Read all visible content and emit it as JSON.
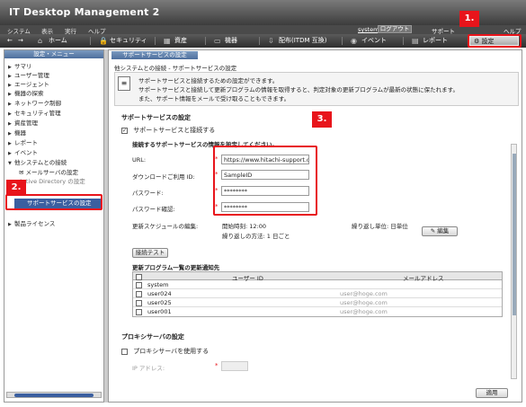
{
  "app_title": "IT Desktop Management 2",
  "menubar": {
    "items": [
      "システム",
      "表示",
      "実行",
      "ヘルプ"
    ],
    "user": "system",
    "logout": "ログアウト",
    "support": "サポート",
    "help": "ヘルプ"
  },
  "navbar": {
    "items": [
      {
        "label": "ホーム",
        "icon": "home-icon"
      },
      {
        "label": "セキュリティ",
        "icon": "lock-icon"
      },
      {
        "label": "資産",
        "icon": "asset-icon"
      },
      {
        "label": "機器",
        "icon": "device-icon"
      },
      {
        "label": "配布(ITDM 互換)",
        "icon": "distribution-icon"
      },
      {
        "label": "イベント",
        "icon": "event-icon"
      },
      {
        "label": "レポート",
        "icon": "report-icon"
      }
    ],
    "settings": "設定"
  },
  "callouts": [
    "1.",
    "2.",
    "3."
  ],
  "sidebar": {
    "header": "設定・メニュー",
    "items": [
      "サマリ",
      "ユーザー管理",
      "エージェント",
      "機器の探索",
      "ネットワーク制御",
      "セキュリティ管理",
      "資産管理",
      "機器",
      "レポート",
      "イベント",
      "他システムとの接続"
    ],
    "sub_items": [
      "メールサーバの設定",
      "Active Directory の設定"
    ],
    "selected": "サポートサービスの設定",
    "below": "製品ライセンス"
  },
  "main": {
    "tab": "サポートサービスの設定",
    "breadcrumb": "他システムとの接続 - サポートサービスの設定",
    "info": [
      "サポートサービスと接続するための設定ができます。",
      "サポートサービスと接続して更新プログラムの情報を取得すると、判定対象の更新プログラムが最新の状態に保たれます。",
      "また、サポート情報をメールで受け取ることもできます。"
    ],
    "section_title": "サポートサービスの設定",
    "connect_checkbox": "サポートサービスと接続する",
    "connect_heading": "接続するサポートサービスの情報を設定してください。",
    "fields": [
      {
        "label": "URL:",
        "value": "https://www.hitachi-support.cc"
      },
      {
        "label": "ダウンロードご利用 ID:",
        "value": "SampleID"
      },
      {
        "label": "パスワード:",
        "value": "********"
      },
      {
        "label": "パスワード確認:",
        "value": "********"
      }
    ],
    "schedule": {
      "label": "更新スケジュールの編集:",
      "start": "開始時刻:  12:00",
      "repeat_unit": "繰り返し単位:  日単位",
      "repeat_method": "繰り返しの方法:  1 日ごと",
      "edit_button": "編集"
    },
    "test_button": "接続テスト",
    "notify_title": "更新プログラム一覧の更新通知先",
    "table": {
      "columns": [
        "ユーザー ID",
        "メールアドレス"
      ],
      "rows": [
        {
          "id": "system",
          "email": ""
        },
        {
          "id": "user024",
          "email": "user@hoge.com"
        },
        {
          "id": "user025",
          "email": "user@hoge.com"
        },
        {
          "id": "user001",
          "email": "user@hoge.com"
        }
      ]
    },
    "proxy_title": "プロキシサーバの設定",
    "proxy_checkbox": "プロキシサーバを使用する",
    "proxy_ip_label": "IP アドレス:",
    "apply_button": "適用"
  }
}
